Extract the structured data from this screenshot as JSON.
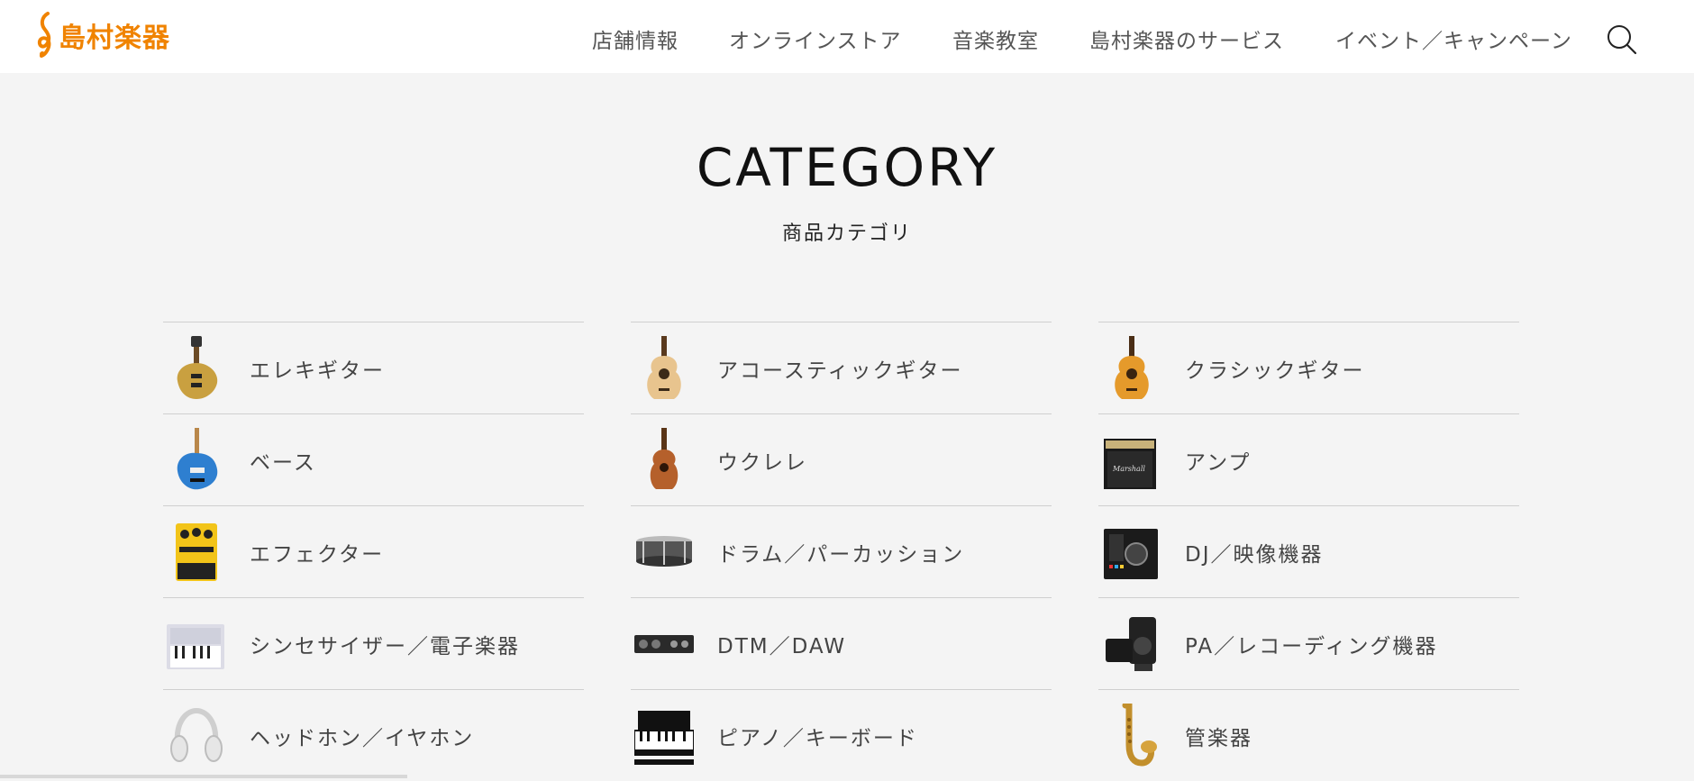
{
  "header": {
    "logo_text": "島村楽器",
    "nav": [
      "店舗情報",
      "オンラインストア",
      "音楽教室",
      "島村楽器のサービス",
      "イベント／キャンペーン"
    ]
  },
  "section": {
    "title": "CATEGORY",
    "subtitle": "商品カテゴリ"
  },
  "categories": [
    {
      "label": "エレキギター",
      "icon": "electric-guitar-icon"
    },
    {
      "label": "アコースティックギター",
      "icon": "acoustic-guitar-icon"
    },
    {
      "label": "クラシックギター",
      "icon": "classical-guitar-icon"
    },
    {
      "label": "ベース",
      "icon": "bass-guitar-icon"
    },
    {
      "label": "ウクレレ",
      "icon": "ukulele-icon"
    },
    {
      "label": "アンプ",
      "icon": "amplifier-icon"
    },
    {
      "label": "エフェクター",
      "icon": "effector-pedal-icon"
    },
    {
      "label": "ドラム／パーカッション",
      "icon": "snare-drum-icon"
    },
    {
      "label": "DJ／映像機器",
      "icon": "dj-controller-icon"
    },
    {
      "label": "シンセサイザー／電子楽器",
      "icon": "synthesizer-icon"
    },
    {
      "label": "DTM／DAW",
      "icon": "audio-interface-icon"
    },
    {
      "label": "PA／レコーディング機器",
      "icon": "pa-speaker-icon"
    },
    {
      "label": "ヘッドホン／イヤホン",
      "icon": "headphones-icon"
    },
    {
      "label": "ピアノ／キーボード",
      "icon": "piano-icon"
    },
    {
      "label": "管楽器",
      "icon": "saxophone-icon"
    }
  ],
  "colors": {
    "brand": "#f08300",
    "background": "#f4f4f4",
    "header_bg": "#ffffff"
  }
}
